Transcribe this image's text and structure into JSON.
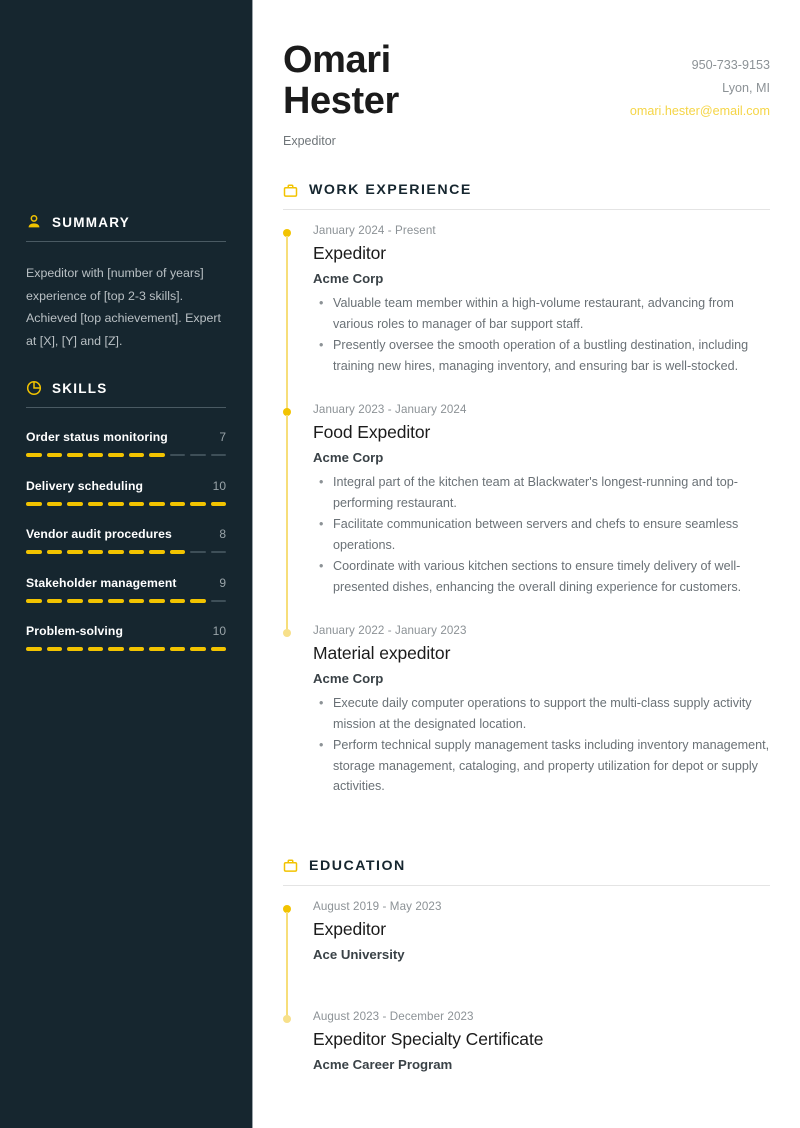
{
  "header": {
    "first_name": "Omari",
    "last_name": "Hester",
    "role": "Expeditor",
    "phone": "950-733-9153",
    "location": "Lyon, MI",
    "email": "omari.hester@email.com"
  },
  "colors": {
    "sidebar_bg": "#16262F",
    "accent": "#F2C300",
    "email_link": "#F5D547",
    "heading": "#16262F"
  },
  "sidebar": {
    "summary": {
      "icon": "person-icon",
      "title": "SUMMARY",
      "text": "Expeditor with [number of years] experience of [top 2-3 skills]. Achieved [top achievement]. Expert at [X], [Y] and [Z]."
    },
    "skills": {
      "icon": "pie-chart-icon",
      "title": "SKILLS",
      "max": 10,
      "items": [
        {
          "name": "Order status monitoring",
          "value": 7
        },
        {
          "name": "Delivery scheduling",
          "value": 10
        },
        {
          "name": "Vendor audit procedures",
          "value": 8
        },
        {
          "name": "Stakeholder management",
          "value": 9
        },
        {
          "name": "Problem-solving",
          "value": 10
        }
      ]
    }
  },
  "main": {
    "work": {
      "icon": "briefcase-icon",
      "title": "WORK EXPERIENCE",
      "entries": [
        {
          "date": "January 2024 - Present",
          "title": "Expeditor",
          "org": "Acme Corp",
          "bullets": [
            "Valuable team member within a high-volume restaurant, advancing from various roles to manager of bar support staff.",
            "Presently oversee the smooth operation of a bustling destination, including training new hires, managing inventory, and ensuring bar is well-stocked."
          ]
        },
        {
          "date": "January 2023 - January 2024",
          "title": "Food Expeditor",
          "org": "Acme Corp",
          "bullets": [
            "Integral part of the kitchen team at Blackwater's longest-running and top-performing restaurant.",
            "Facilitate communication between servers and chefs to ensure seamless operations.",
            "Coordinate with various kitchen sections to ensure timely delivery of well-presented dishes, enhancing the overall dining experience for customers."
          ]
        },
        {
          "date": "January 2022 - January 2023",
          "title": "Material expeditor",
          "org": "Acme Corp",
          "bullets": [
            "Execute daily computer operations to support the multi-class supply activity mission at the designated location.",
            "Perform technical supply management tasks including inventory management, storage management, cataloging, and property utilization for depot or supply activities."
          ]
        }
      ]
    },
    "education": {
      "icon": "briefcase-icon",
      "title": "EDUCATION",
      "entries": [
        {
          "date": "August 2019 - May 2023",
          "title": "Expeditor",
          "org": "Ace University"
        },
        {
          "date": "August 2023 - December 2023",
          "title": "Expeditor Specialty Certificate",
          "org": "Acme Career Program"
        }
      ]
    }
  }
}
